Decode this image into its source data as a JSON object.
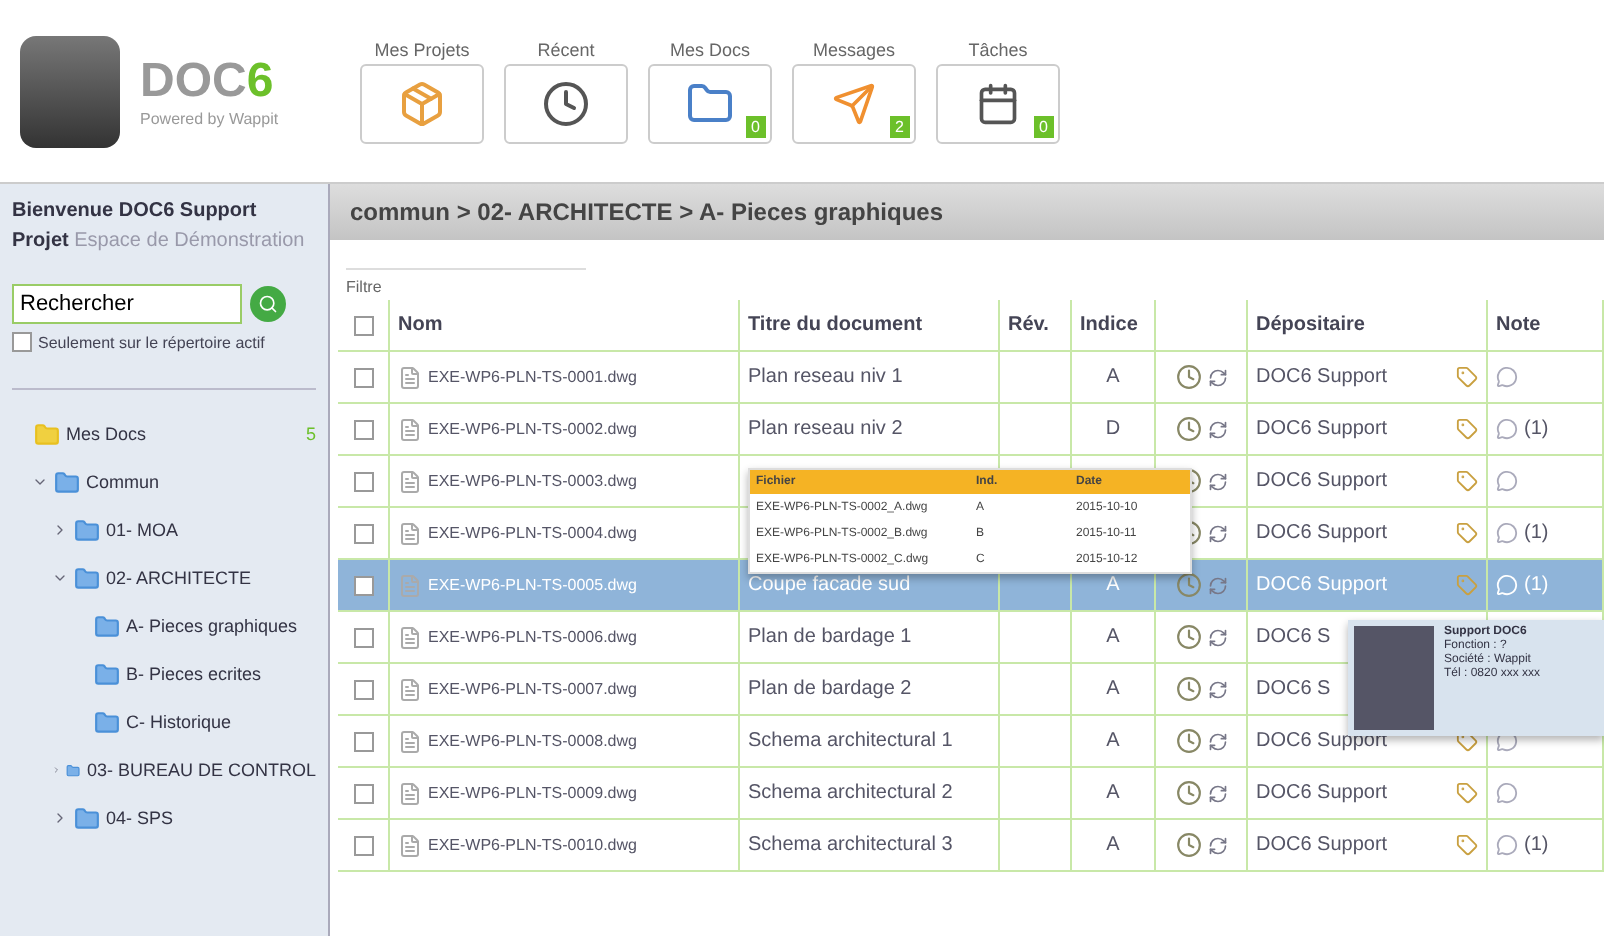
{
  "brand": {
    "name": "DOC",
    "digit": "6",
    "tagline": "Powered by Wappit"
  },
  "nav": [
    {
      "kind": "projects",
      "label": "Mes Projets"
    },
    {
      "kind": "recent",
      "label": "Récent"
    },
    {
      "kind": "docs",
      "label": "Mes Docs",
      "badge": "0"
    },
    {
      "kind": "messages",
      "label": "Messages",
      "badge": "2"
    },
    {
      "kind": "tasks",
      "label": "Tâches",
      "badge": "0"
    }
  ],
  "sidebar": {
    "welcome": "Bienvenue DOC6 Support",
    "project_label": "Projet",
    "project_name": "Espace de Démonstration",
    "search": {
      "value": "Rechercher"
    },
    "only_active": {
      "label": "Seulement sur le répertoire actif",
      "checked": false
    },
    "tree": [
      {
        "label": "Mes Docs",
        "count": "5",
        "kind": "root",
        "children": [
          {
            "label": "Commun",
            "expanded": true,
            "children": [
              {
                "label": "01- MOA",
                "expanded": false
              },
              {
                "label": "02- ARCHITECTE",
                "expanded": true,
                "children": [
                  {
                    "label": "A- Pieces graphiques"
                  },
                  {
                    "label": "B- Pieces ecrites"
                  },
                  {
                    "label": "C- Historique"
                  }
                ]
              },
              {
                "label": "03- BUREAU DE CONTROL",
                "expanded": false
              },
              {
                "label": "04- SPS",
                "expanded": false
              }
            ]
          }
        ]
      }
    ]
  },
  "breadcrumb": "commun > 02- ARCHITECTE > A- Pieces graphiques",
  "filter_label": "Filtre",
  "table": {
    "all_checked": false,
    "columns": [
      "Nom",
      "Titre du document",
      "Rév.",
      "Indice",
      "Dépositaire",
      "Note"
    ],
    "rows": [
      {
        "name": "EXE-WP6-PLN-TS-0001.dwg",
        "title": "Plan reseau niv 1",
        "indice": "A",
        "owner": "DOC6 Support",
        "checked": false,
        "selected": false
      },
      {
        "name": "EXE-WP6-PLN-TS-0002.dwg",
        "title": "Plan reseau niv 2",
        "indice": "D",
        "owner": "DOC6 Support",
        "notes": "(1)",
        "checked": false,
        "selected": false
      },
      {
        "name": "EXE-WP6-PLN-TS-0003.dwg",
        "owner": "DOC6 Support",
        "checked": false,
        "selected": false
      },
      {
        "name": "EXE-WP6-PLN-TS-0004.dwg",
        "owner": "DOC6 Support",
        "notes": "(1)",
        "checked": false,
        "selected": false
      },
      {
        "name": "EXE-WP6-PLN-TS-0005.dwg",
        "title": "Coupe facade sud",
        "indice": "A",
        "owner": "DOC6 Support",
        "notes": "(1)",
        "checked": false,
        "selected": true
      },
      {
        "name": "EXE-WP6-PLN-TS-0006.dwg",
        "title": "Plan de bardage 1",
        "indice": "A",
        "owner": "DOC6 S",
        "checked": false,
        "selected": false
      },
      {
        "name": "EXE-WP6-PLN-TS-0007.dwg",
        "title": "Plan de bardage 2",
        "indice": "A",
        "owner": "DOC6 S",
        "checked": false,
        "selected": false
      },
      {
        "name": "EXE-WP6-PLN-TS-0008.dwg",
        "title": "Schema architectural 1",
        "indice": "A",
        "owner": "DOC6 Support",
        "checked": false,
        "selected": false
      },
      {
        "name": "EXE-WP6-PLN-TS-0009.dwg",
        "title": "Schema architectural 2",
        "indice": "A",
        "owner": "DOC6 Support",
        "checked": false,
        "selected": false
      },
      {
        "name": "EXE-WP6-PLN-TS-0010.dwg",
        "title": "Schema architectural 3",
        "indice": "A",
        "owner": "DOC6 Support",
        "notes": "(1)",
        "checked": false,
        "selected": false
      }
    ]
  },
  "versions_popup": {
    "columns": [
      "Fichier",
      "Ind.",
      "Date"
    ],
    "rows": [
      [
        "EXE-WP6-PLN-TS-0002_A.dwg",
        "A",
        "2015-10-10"
      ],
      [
        "EXE-WP6-PLN-TS-0002_B.dwg",
        "B",
        "2015-10-11"
      ],
      [
        "EXE-WP6-PLN-TS-0002_C.dwg",
        "C",
        "2015-10-12"
      ]
    ]
  },
  "user_card": {
    "name": "Support DOC6",
    "lines": [
      "Fonction : ?",
      "Société : Wappit",
      "Tél : 0820 xxx xxx"
    ]
  }
}
